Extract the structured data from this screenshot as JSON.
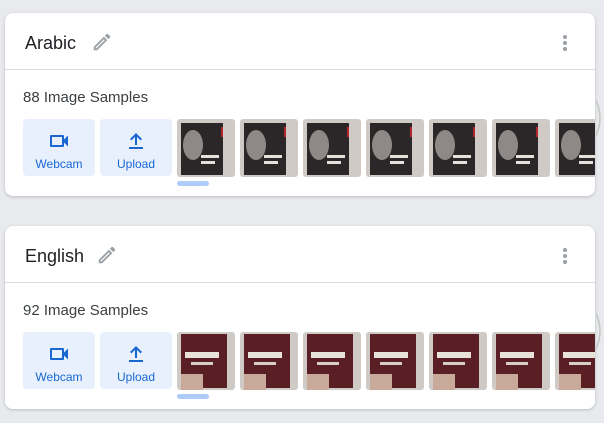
{
  "classes": [
    {
      "name": "Arabic",
      "samples_label": "88 Image Samples",
      "webcam_label": "Webcam",
      "upload_label": "Upload",
      "thumbnail_count_visible": 7,
      "book_title": "Arabic book cover"
    },
    {
      "name": "English",
      "samples_label": "92 Image Samples",
      "webcam_label": "Webcam",
      "upload_label": "Upload",
      "thumbnail_count_visible": 7,
      "book_title": "NoSQL book cover"
    }
  ],
  "icons": {
    "edit": "pencil-icon",
    "more": "more-vert-icon",
    "webcam": "videocam-icon",
    "upload": "upload-icon"
  },
  "colors": {
    "accent": "#1967d2",
    "button_bg": "#e8f0fe",
    "page_bg": "#e8eaed"
  }
}
